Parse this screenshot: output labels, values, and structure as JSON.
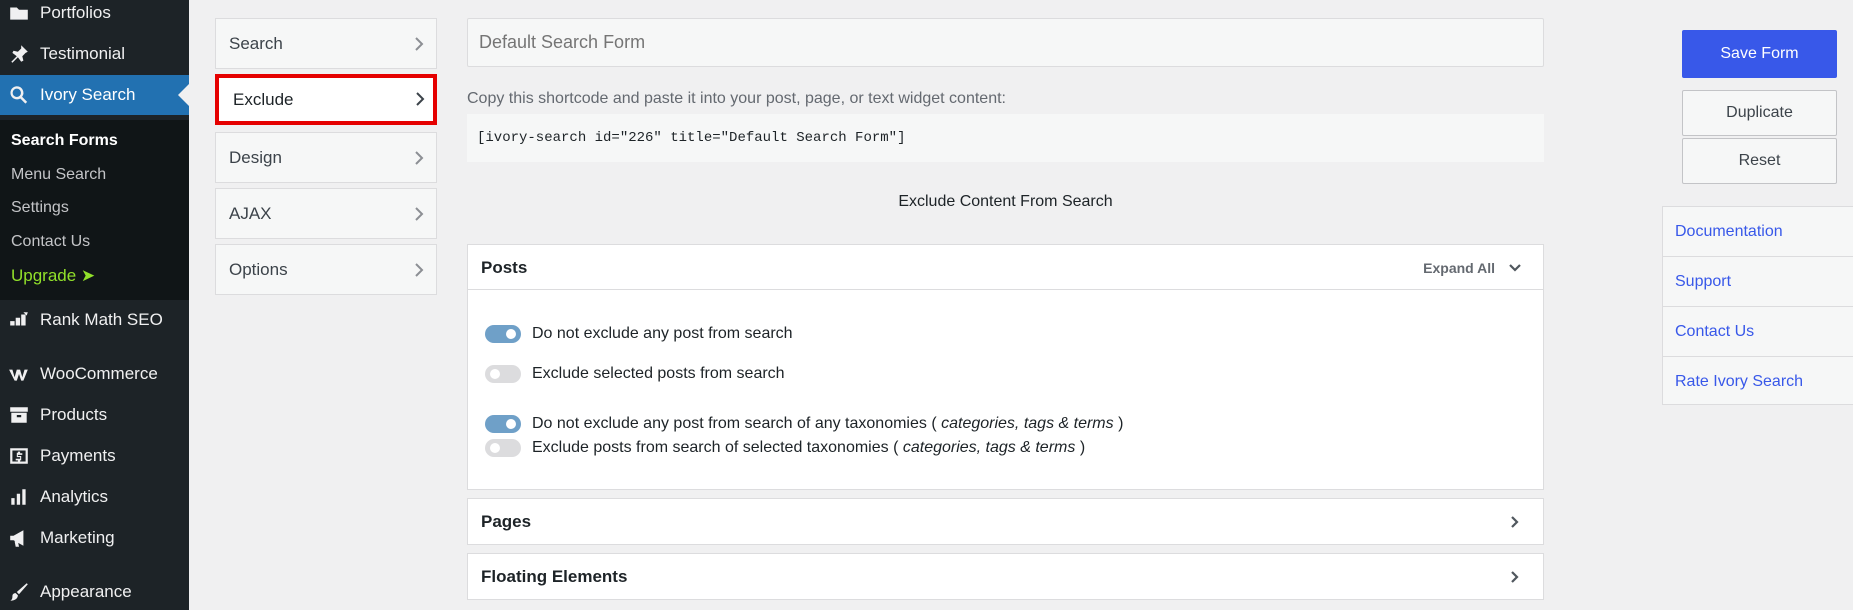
{
  "sidebar": {
    "items": [
      {
        "label": "Portfolios",
        "icon": "folder-icon"
      },
      {
        "label": "Testimonial",
        "icon": "pin-icon"
      },
      {
        "label": "Ivory Search",
        "icon": "search-icon"
      },
      {
        "label": "Rank Math SEO",
        "icon": "rank-math-icon"
      },
      {
        "label": "WooCommerce",
        "icon": "woo-icon"
      },
      {
        "label": "Products",
        "icon": "archive-icon"
      },
      {
        "label": "Payments",
        "icon": "dollar-icon"
      },
      {
        "label": "Analytics",
        "icon": "bar-chart-icon"
      },
      {
        "label": "Marketing",
        "icon": "megaphone-icon"
      },
      {
        "label": "Appearance",
        "icon": "brush-icon"
      }
    ],
    "submenu": [
      {
        "label": "Search Forms"
      },
      {
        "label": "Menu Search"
      },
      {
        "label": "Settings"
      },
      {
        "label": "Contact Us"
      },
      {
        "label": "Upgrade ➤"
      }
    ]
  },
  "tabs": [
    {
      "label": "Search"
    },
    {
      "label": "Exclude"
    },
    {
      "label": "Design"
    },
    {
      "label": "AJAX"
    },
    {
      "label": "Options"
    }
  ],
  "form": {
    "title_placeholder": "Default Search Form",
    "copy_text": "Copy this shortcode and paste it into your post, page, or text widget content:",
    "shortcode": "[ivory-search id=\"226\" title=\"Default Search Form\"]",
    "section_heading": "Exclude Content From Search"
  },
  "posts_panel": {
    "title": "Posts",
    "expand_all": "Expand All",
    "options": [
      {
        "label": "Do not exclude any post from search",
        "on": true
      },
      {
        "label": "Exclude selected posts from search",
        "on": false
      },
      {
        "label": "Do not exclude any post from search of any taxonomies (",
        "em": "categories, tags & terms",
        "after": ")",
        "on": true
      },
      {
        "label": "Exclude posts from search of selected taxonomies (",
        "em": "categories, tags & terms",
        "after": ")",
        "on": false
      }
    ]
  },
  "pages_panel": {
    "title": "Pages"
  },
  "floating_panel": {
    "title": "Floating Elements"
  },
  "actions": {
    "save": "Save Form",
    "duplicate": "Duplicate",
    "reset": "Reset"
  },
  "links": [
    {
      "label": "Documentation"
    },
    {
      "label": "Support"
    },
    {
      "label": "Contact Us"
    },
    {
      "label": "Rate Ivory Search"
    }
  ],
  "colors": {
    "primary": "#3858e9",
    "active_menu": "#2271b1",
    "highlight_border": "#e50000",
    "upgrade": "#91e02a"
  }
}
